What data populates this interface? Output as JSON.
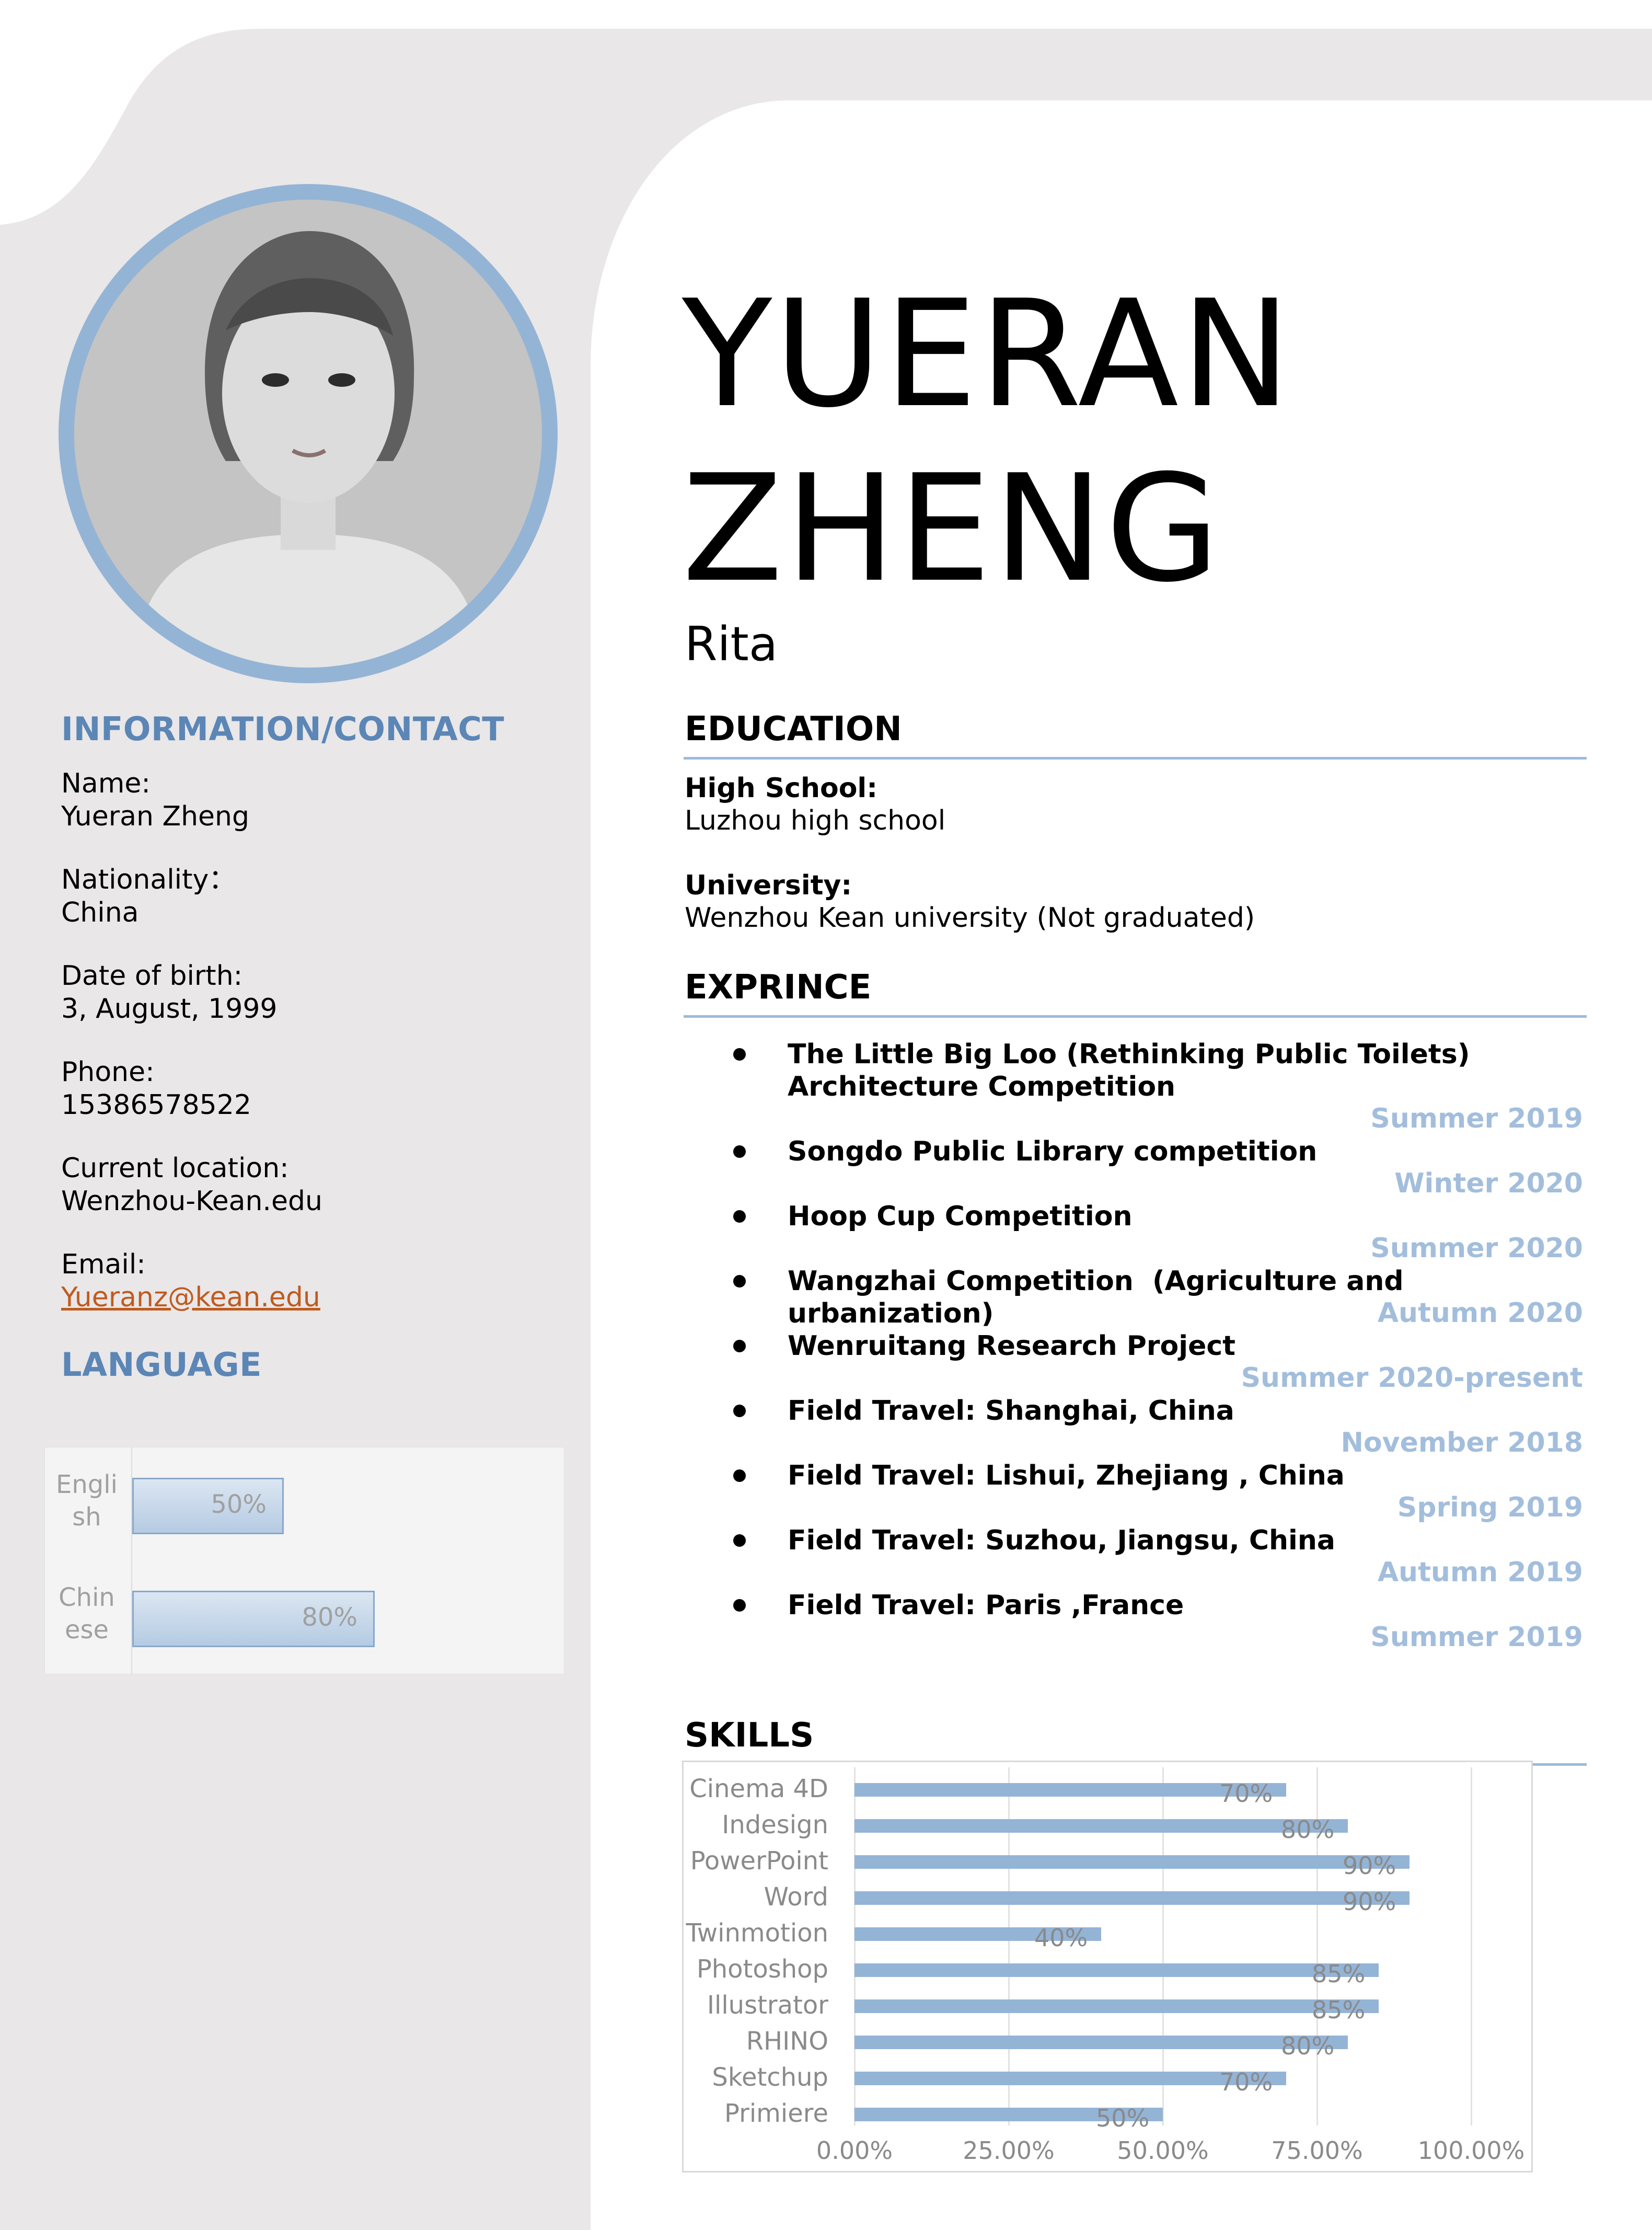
{
  "colors": {
    "panel_bg": "#e9e7e8",
    "accent_blue": "#94b4d6",
    "heading_blue": "#5b86b6",
    "date_blue": "#a3bedc",
    "link_orange": "#c05a1e"
  },
  "profile": {
    "first_name": "YUERAN",
    "last_name": "ZHENG",
    "nickname": "Rita",
    "photo": "portrait-photo"
  },
  "contact": {
    "heading": "INFORMATION/CONTACT",
    "items": [
      {
        "label": "Name:",
        "value": "Yueran Zheng"
      },
      {
        "label": "Nationality：",
        "value": "China"
      },
      {
        "label": "Date of birth:",
        "value": "3, August, 1999"
      },
      {
        "label": "Phone:",
        "value": "15386578522"
      },
      {
        "label": "Current location:",
        "value": "Wenzhou-Kean.edu"
      },
      {
        "label": "Email:",
        "value": "Yueranz@kean.edu"
      }
    ]
  },
  "language": {
    "heading": "LANGUAGE",
    "chart_data": {
      "type": "bar",
      "orientation": "horizontal",
      "categories": [
        "English",
        "Chinese"
      ],
      "category_labels": [
        [
          "Engli",
          "sh"
        ],
        [
          "Chin",
          "ese"
        ]
      ],
      "values": [
        50,
        80
      ],
      "value_labels": [
        "50%",
        "80%"
      ],
      "xlim": [
        0,
        100
      ]
    }
  },
  "education": {
    "heading": "EDUCATION",
    "entries": [
      {
        "label": "High School:",
        "value": "Luzhou high school"
      },
      {
        "label": "University:",
        "value": "Wenzhou Kean university (Not graduated)"
      }
    ]
  },
  "experience": {
    "heading": "EXPRINCE",
    "items": [
      {
        "title": "The Little Big Loo (Rethinking Public Toilets) Architecture Competition",
        "date": "Summer 2019"
      },
      {
        "title": "Songdo Public Library competition",
        "date": "Winter 2020"
      },
      {
        "title": "Hoop Cup Competition",
        "date": "Summer 2020"
      },
      {
        "title": "Wangzhai Competition  (Agriculture and urbanization)",
        "date": "Autumn 2020"
      },
      {
        "title": "Wenruitang Research Project",
        "date": "Summer 2020-present"
      },
      {
        "title": "Field Travel: Shanghai, China",
        "date": "November 2018"
      },
      {
        "title": "Field Travel: Lishui, Zhejiang , China",
        "date": "Spring 2019"
      },
      {
        "title": "Field Travel: Suzhou, Jiangsu, China",
        "date": "Autumn 2019"
      },
      {
        "title": "Field Travel: Paris ,France",
        "date": "Summer 2019"
      }
    ]
  },
  "skills": {
    "heading": "SKILLS",
    "chart_data": {
      "type": "bar",
      "orientation": "horizontal",
      "categories": [
        "Cinema 4D",
        "Indesign",
        "PowerPoint",
        "Word",
        "Twinmotion",
        "Photoshop",
        "Illustrator",
        "RHINO",
        "Sketchup",
        "Primiere"
      ],
      "values": [
        70,
        80,
        90,
        90,
        40,
        85,
        85,
        80,
        70,
        50
      ],
      "value_labels": [
        "70%",
        "80%",
        "90%",
        "90%",
        "40%",
        "85%",
        "85%",
        "80%",
        "70%",
        "50%"
      ],
      "xticks": [
        "0.00%",
        "25.00%",
        "50.00%",
        "75.00%",
        "100.00%"
      ],
      "xlim": [
        0,
        100
      ],
      "grid": true
    }
  }
}
